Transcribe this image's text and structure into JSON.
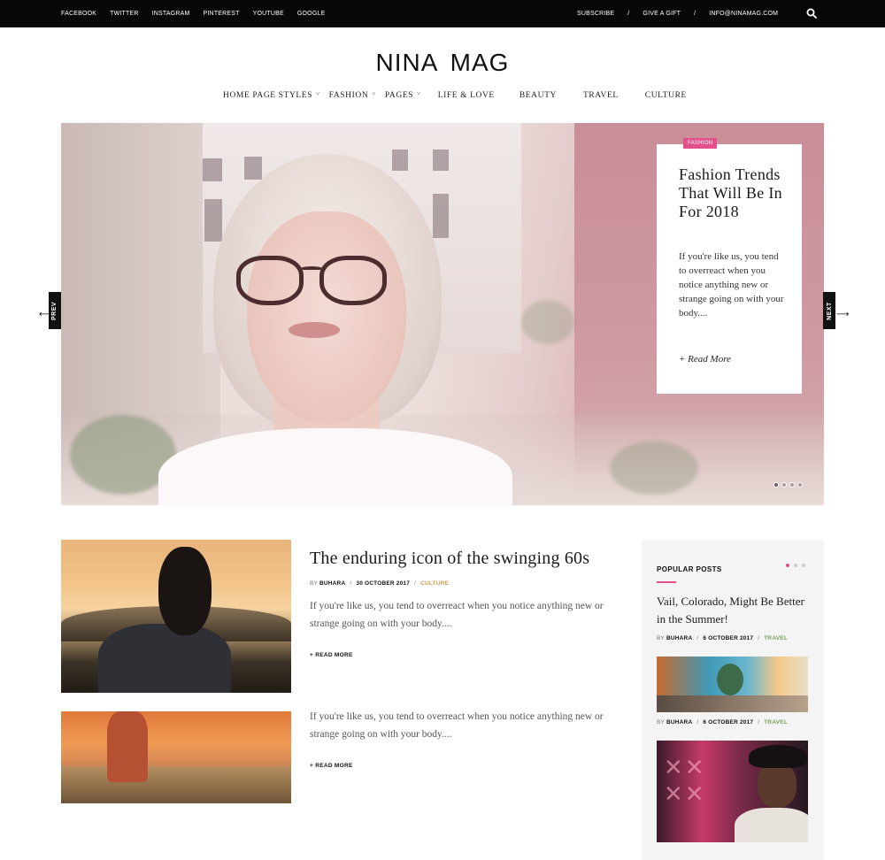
{
  "topbar": {
    "social": [
      "FACEBOOK",
      "TWITTER",
      "INSTAGRAM",
      "PINTEREST",
      "YOUTUBE",
      "GOOGLE"
    ],
    "subscribe": "SUBSCRIBE",
    "sep1": "/",
    "gift": "GIVE A GIFT",
    "sep2": "/",
    "email": "INFO@NINAMAG.COM",
    "search_icon": "search-icon"
  },
  "logo": "NINA MAG",
  "nav": {
    "items": [
      {
        "label": "HOME PAGE STYLES",
        "dropdown": "˅"
      },
      {
        "label": "FASHION",
        "dropdown": "˅"
      },
      {
        "label": "PAGES",
        "dropdown": "˅"
      },
      {
        "label": "LIFE & LOVE"
      },
      {
        "label": "BEAUTY"
      },
      {
        "label": "TRAVEL"
      },
      {
        "label": "CULTURE"
      }
    ]
  },
  "hero": {
    "badge": "FASHION",
    "title": "Fashion Trends That Will Be In For 2018",
    "excerpt": "If you're like us, you tend to overreact when you notice anything new or strange going on with your body....",
    "read_more": "+ Read More",
    "prev": "PREV",
    "next": "NEXT",
    "slide_count": 4,
    "active_slide": 1,
    "accent": "#e2518a"
  },
  "posts": [
    {
      "title": "The enduring icon of the swinging 60s",
      "by": "BY",
      "author": "BUHARA",
      "sep1": "/",
      "date": "30 OCTOBER 2017",
      "sep2": "/",
      "category": "CULTURE",
      "excerpt": "If you're like us, you tend to overreact when you notice anything new or strange going on with your body....",
      "read_more": "+ READ MORE"
    },
    {
      "excerpt": "If you're like us, you tend to overreact when you notice anything new or strange going on with your body....",
      "read_more": "+ READ MORE"
    }
  ],
  "sidebar": {
    "title": "POPULAR POSTS",
    "active_dot": 1,
    "post1": {
      "title": "Vail, Colorado, Might Be Better in the Summer!",
      "by": "BY",
      "author": "BUHARA",
      "sep1": "/",
      "date": "6 OCTOBER 2017",
      "sep2": "/",
      "category": "TRAVEL"
    },
    "post2": {
      "by": "BY",
      "author": "BUHARA",
      "sep1": "/",
      "date": "6 OCTOBER 2017",
      "sep2": "/",
      "category": "TRAVEL"
    }
  },
  "colors": {
    "topbar": "#070707",
    "pink": "#e2518a",
    "culture": "#caa055",
    "travel": "#7ba05b"
  }
}
